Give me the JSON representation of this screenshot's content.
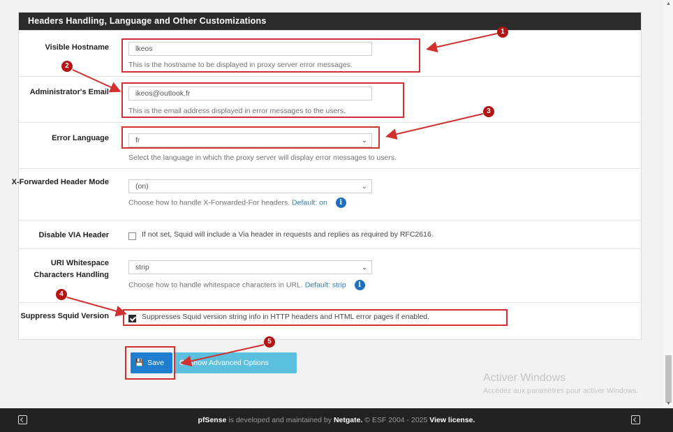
{
  "panel": {
    "title": "Headers Handling, Language and Other Customizations"
  },
  "rows": {
    "hostname": {
      "label": "Visible Hostname",
      "value": "lkeos",
      "help": "This is the hostname to be displayed in proxy server error messages."
    },
    "email": {
      "label": "Administrator's Email",
      "value": "ikeos@outlook.fr",
      "help": "This is the email address displayed in error messages to the users."
    },
    "language": {
      "label": "Error Language",
      "value": "fr",
      "help": "Select the language in which the proxy server will display error messages to users."
    },
    "xforwarded": {
      "label": "X-Forwarded Header Mode",
      "value": "(on)",
      "help": "Choose how to handle X-Forwarded-For headers.",
      "default_text": "Default: on"
    },
    "via": {
      "label": "Disable VIA Header",
      "checked": false,
      "text": "If not set, Squid will include a Via header in requests and replies as required by RFC2616."
    },
    "uri": {
      "label": "URI Whitespace Characters Handling",
      "value": "strip",
      "help": "Choose how to handle whitespace characters in URL.",
      "default_text": "Default: strip"
    },
    "suppress": {
      "label": "Suppress Squid Version",
      "checked": true,
      "text": "Suppresses Squid version string info in HTTP headers and HTML error pages if enabled."
    }
  },
  "buttons": {
    "save": "Save",
    "advanced": "Show Advanced Options"
  },
  "markers": [
    "1",
    "2",
    "3",
    "4",
    "5"
  ],
  "footer": {
    "brand": "pfSense",
    "text1": " is developed and maintained by ",
    "company": "Netgate.",
    "text2": " © ESF 2004 - 2025 ",
    "license": "View license."
  },
  "watermark": {
    "title": "Activer Windows",
    "subtitle": "Accédez aux paramètres pour activer Windows."
  },
  "colors": {
    "annotation": "#d03030",
    "heading": "#2b2b2b",
    "save_button": "#1e7fd0",
    "advanced_button": "#5bc0de"
  }
}
